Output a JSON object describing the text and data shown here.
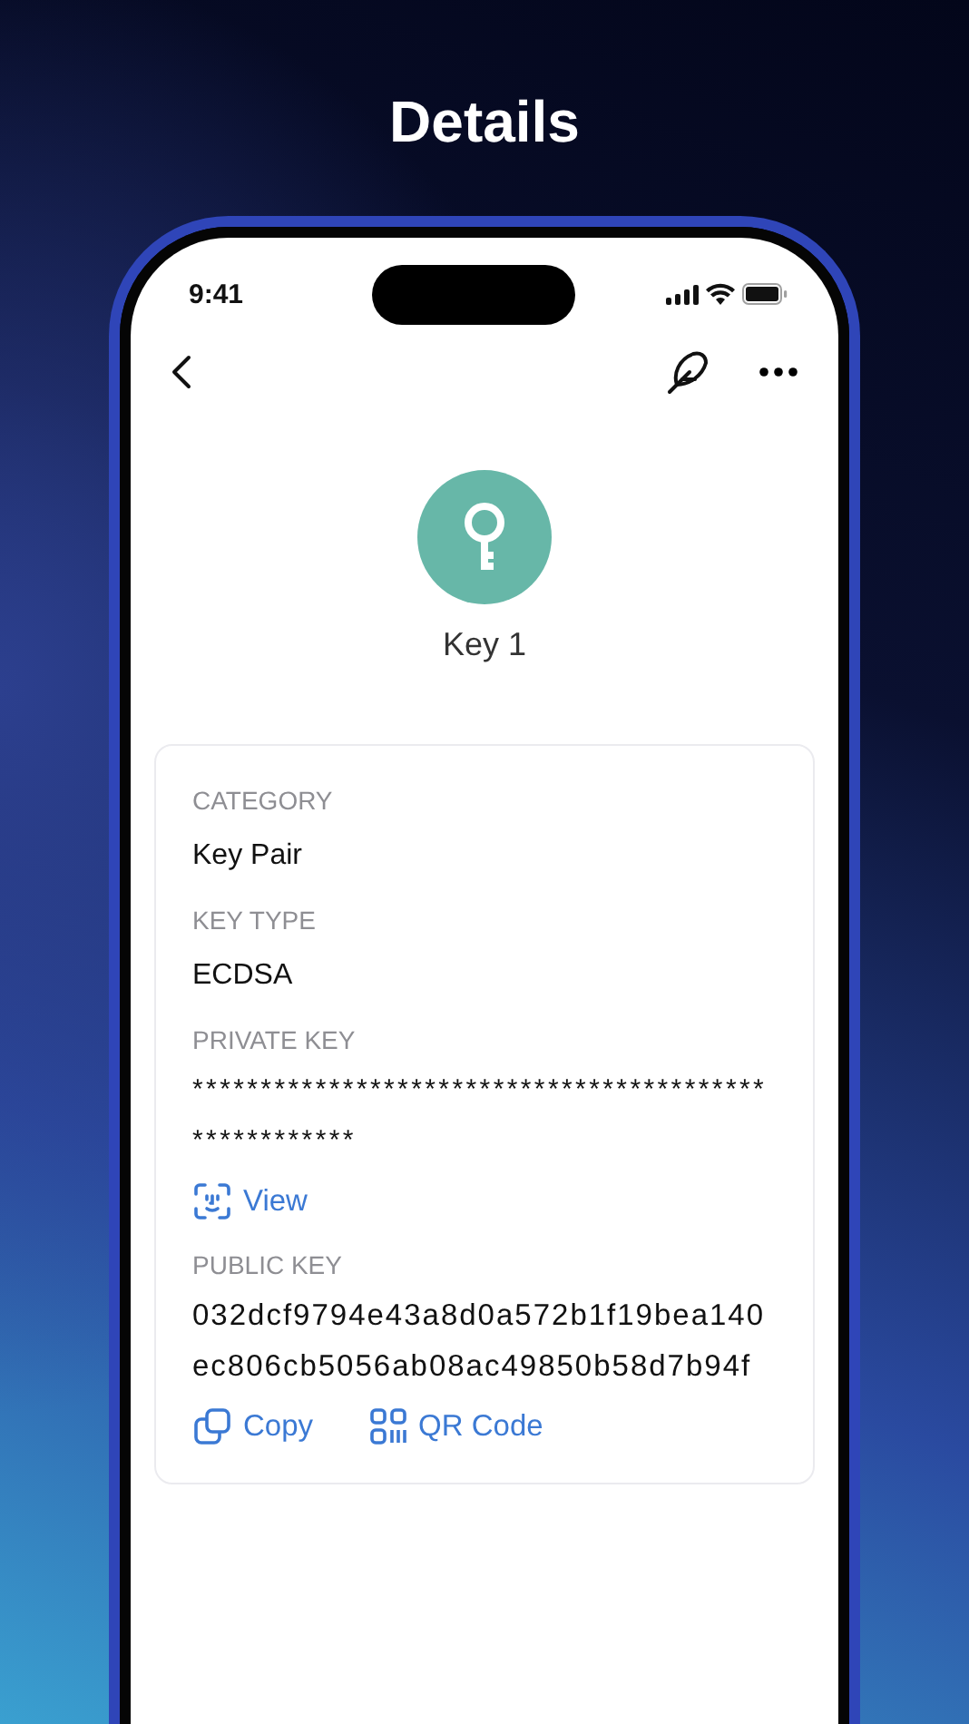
{
  "page_title": "Details",
  "status_bar": {
    "time": "9:41"
  },
  "key": {
    "name": "Key 1"
  },
  "fields": [
    {
      "kind": "text",
      "label": "CATEGORY",
      "value": "Key Pair"
    },
    {
      "kind": "text",
      "label": "KEY TYPE",
      "value": "ECDSA"
    },
    {
      "kind": "secret",
      "label": "PRIVATE KEY",
      "value": "******************************************************",
      "actions": [
        {
          "kind": "view",
          "label": "View"
        }
      ]
    },
    {
      "kind": "text",
      "label": "PUBLIC KEY",
      "value": "032dcf9794e43a8d0a572b1f19bea140ec806cb5056ab08ac49850b58d7b94f",
      "actions": [
        {
          "kind": "copy",
          "label": "Copy"
        },
        {
          "kind": "qr",
          "label": "QR Code"
        }
      ]
    }
  ]
}
